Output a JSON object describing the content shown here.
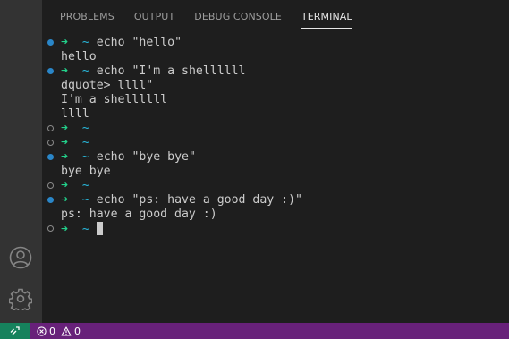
{
  "panel": {
    "tabs": [
      {
        "label": "PROBLEMS"
      },
      {
        "label": "OUTPUT"
      },
      {
        "label": "DEBUG CONSOLE"
      },
      {
        "label": "TERMINAL"
      }
    ],
    "active_tab": "TERMINAL"
  },
  "terminal": {
    "prompt_arrow": "➜",
    "prompt_dir": "~",
    "lines": [
      {
        "kind": "cmd",
        "dot": "filled",
        "text": "echo \"hello\""
      },
      {
        "kind": "out",
        "text": "hello"
      },
      {
        "kind": "cmd",
        "dot": "filled",
        "text": "echo \"I'm a shellllll"
      },
      {
        "kind": "out",
        "text": "dquote> llll\""
      },
      {
        "kind": "out",
        "text": "I'm a shellllll"
      },
      {
        "kind": "out",
        "text": "llll"
      },
      {
        "kind": "cmd",
        "dot": "hollow",
        "text": ""
      },
      {
        "kind": "cmd",
        "dot": "hollow",
        "text": ""
      },
      {
        "kind": "cmd",
        "dot": "filled",
        "text": "echo \"bye bye\""
      },
      {
        "kind": "out",
        "text": "bye bye"
      },
      {
        "kind": "cmd",
        "dot": "hollow",
        "text": ""
      },
      {
        "kind": "cmd",
        "dot": "filled",
        "text": "echo \"ps: have a good day :)\""
      },
      {
        "kind": "out",
        "text": "ps: have a good day :)"
      },
      {
        "kind": "cmd",
        "dot": "hollow",
        "text": "",
        "cursor": true
      }
    ]
  },
  "activity_bar": {
    "icons": [
      "account-icon",
      "gear-icon"
    ]
  },
  "statusbar": {
    "errors": "0",
    "warnings": "0",
    "colors": {
      "bar": "#68217a",
      "remote": "#16825d"
    }
  }
}
